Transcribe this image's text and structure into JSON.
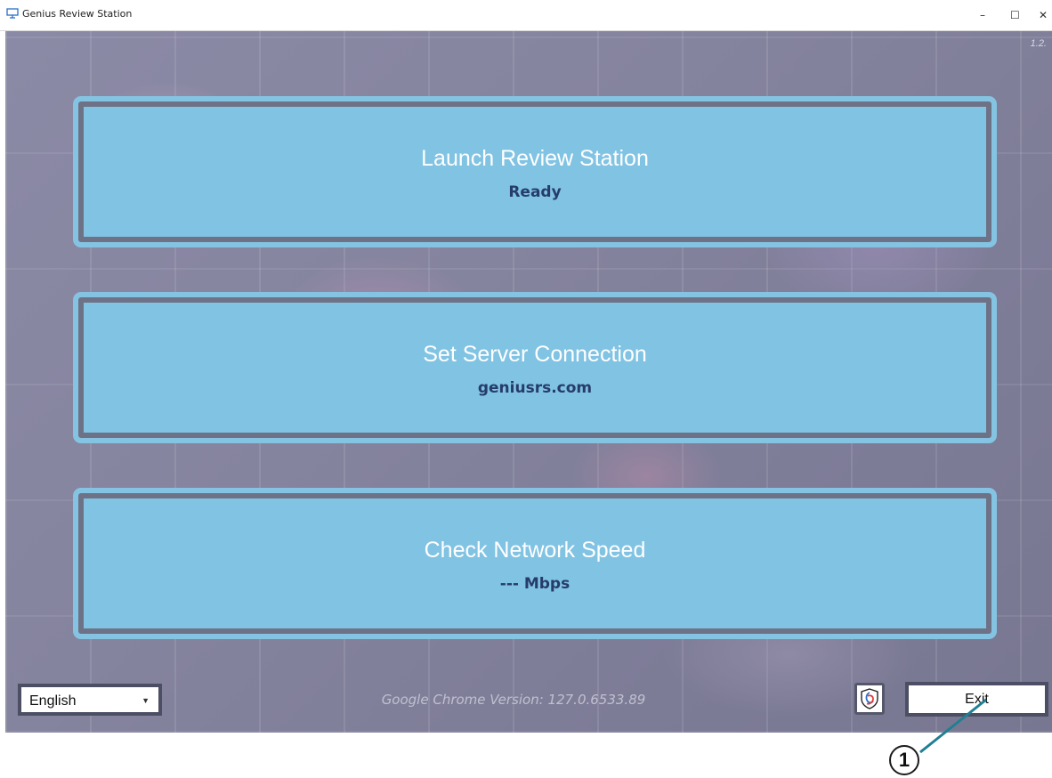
{
  "window": {
    "title": "Genius Review Station",
    "controls": {
      "minimize": "–",
      "maximize": "☐",
      "close": "✕"
    }
  },
  "version": "1.2.",
  "panels": [
    {
      "title": "Launch Review Station",
      "subtitle": "Ready"
    },
    {
      "title": "Set Server Connection",
      "subtitle": "geniusrs.com"
    },
    {
      "title": "Check Network Speed",
      "subtitle": "--- Mbps"
    }
  ],
  "footer": {
    "language": "English",
    "chrome_version": "Google Chrome Version:  127.0.6533.89",
    "exit_label": "Exit"
  },
  "callout": {
    "number": "1"
  },
  "colors": {
    "panel_fill": "#81c3e3",
    "panel_border": "#84c4e2",
    "subtitle_text": "#263c6b",
    "leader_line": "#1f7f93"
  },
  "icons": {
    "app": "monitor-icon",
    "shield": "shield-icon",
    "dropdown": "chevron-down-icon"
  }
}
